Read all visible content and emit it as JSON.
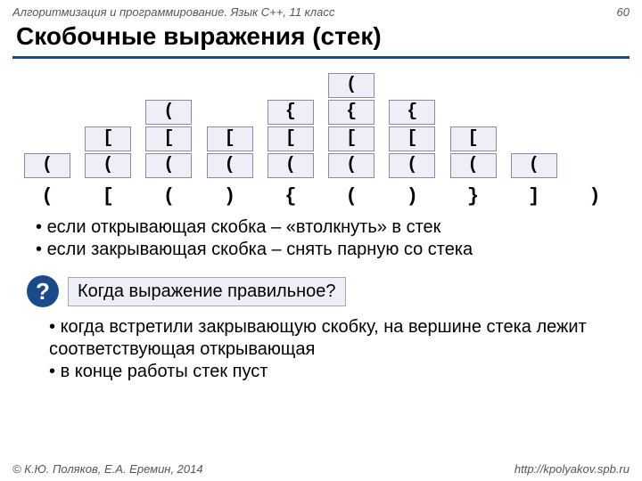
{
  "header": {
    "subject": "Алгоритмизация и программирование. Язык C++, 11 класс",
    "page": "60"
  },
  "title": "Скобочные выражения (стек)",
  "stacks": [
    {
      "cells": [
        "("
      ],
      "input": "("
    },
    {
      "cells": [
        "[",
        "("
      ],
      "input": "["
    },
    {
      "cells": [
        "(",
        "[",
        "("
      ],
      "input": "("
    },
    {
      "cells": [
        "[",
        "("
      ],
      "input": ")"
    },
    {
      "cells": [
        "{",
        "[",
        "("
      ],
      "input": "{"
    },
    {
      "cells": [
        "(",
        "{",
        "[",
        "("
      ],
      "input": "("
    },
    {
      "cells": [
        "{",
        "[",
        "("
      ],
      "input": ")"
    },
    {
      "cells": [
        "[",
        "("
      ],
      "input": "}"
    },
    {
      "cells": [
        "("
      ],
      "input": "]"
    },
    {
      "cells": [],
      "input": ")"
    }
  ],
  "rules": {
    "open": "если открывающая скобка – «втолкнуть» в стек",
    "close": "если закрывающая скобка – снять парную со стека"
  },
  "question": {
    "badge": "?",
    "text": "Когда выражение правильное?"
  },
  "answers": {
    "a1": "когда встретили закрывающую скобку, на вершине стека лежит соответствующая открывающая",
    "a2": "в конце работы стек пуст"
  },
  "footer": {
    "credits": "© К.Ю. Поляков, Е.А. Еремин, 2014",
    "url": "http://kpolyakov.spb.ru"
  }
}
